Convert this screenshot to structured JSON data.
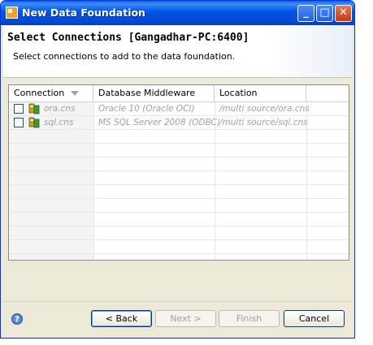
{
  "window": {
    "title": "New Data Foundation",
    "controls": {
      "minimize": "_",
      "maximize": "□",
      "close": "✕"
    }
  },
  "header": {
    "title": "Select Connections [Gangadhar-PC:6400]",
    "description": "Select connections to add to the data foundation."
  },
  "table": {
    "columns": [
      "Connection",
      "Database Middleware",
      "Location"
    ],
    "rows": [
      {
        "name": "ora.cns",
        "middleware": "Oracle 10 (Oracle OCI)",
        "location": "/multi source/ora.cns",
        "checked": false,
        "icon": "connection-icon"
      },
      {
        "name": "sql.cns",
        "middleware": "MS SQL Server 2008 (ODBC)",
        "location": "/multi source/sql.cns",
        "checked": false,
        "icon": "connection-icon"
      }
    ]
  },
  "buttons": {
    "back": "< Back",
    "next": "Next >",
    "finish": "Finish",
    "cancel": "Cancel"
  },
  "help": {
    "icon": "help-icon",
    "label": "?"
  }
}
